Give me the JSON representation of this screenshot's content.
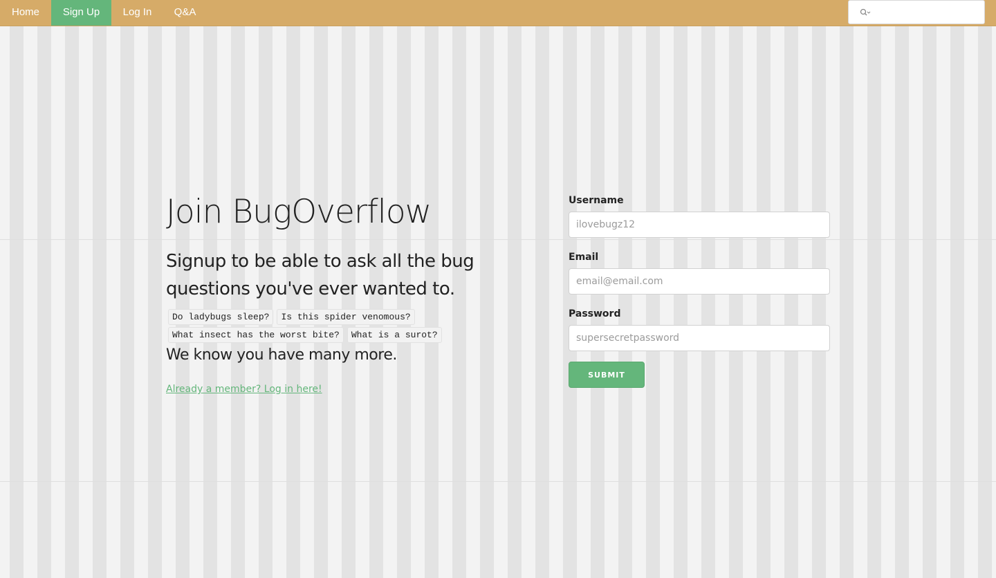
{
  "nav": {
    "items": [
      {
        "label": "Home",
        "active": false
      },
      {
        "label": "Sign Up",
        "active": true
      },
      {
        "label": "Log In",
        "active": false
      },
      {
        "label": "Q&A",
        "active": false
      }
    ],
    "search_placeholder": ""
  },
  "intro": {
    "title": "Join BugOverflow",
    "subtitle": "Signup to be able to ask all the bug questions you've ever wanted to.",
    "example_questions": [
      "Do ladybugs sleep?",
      "Is this spider venomous?",
      "What insect has the worst bite?",
      "What is a surot?"
    ],
    "more_text": "We know you have many more.",
    "login_link": "Already a member? Log in here!"
  },
  "form": {
    "username_label": "Username",
    "username_placeholder": "ilovebugz12",
    "email_label": "Email",
    "email_placeholder": "email@email.com",
    "password_label": "Password",
    "password_placeholder": "supersecretpassword",
    "submit_label": "SUBMIT"
  },
  "colors": {
    "navbar": "#d6ab68",
    "accent": "#64b67b",
    "background": "#ececec"
  }
}
